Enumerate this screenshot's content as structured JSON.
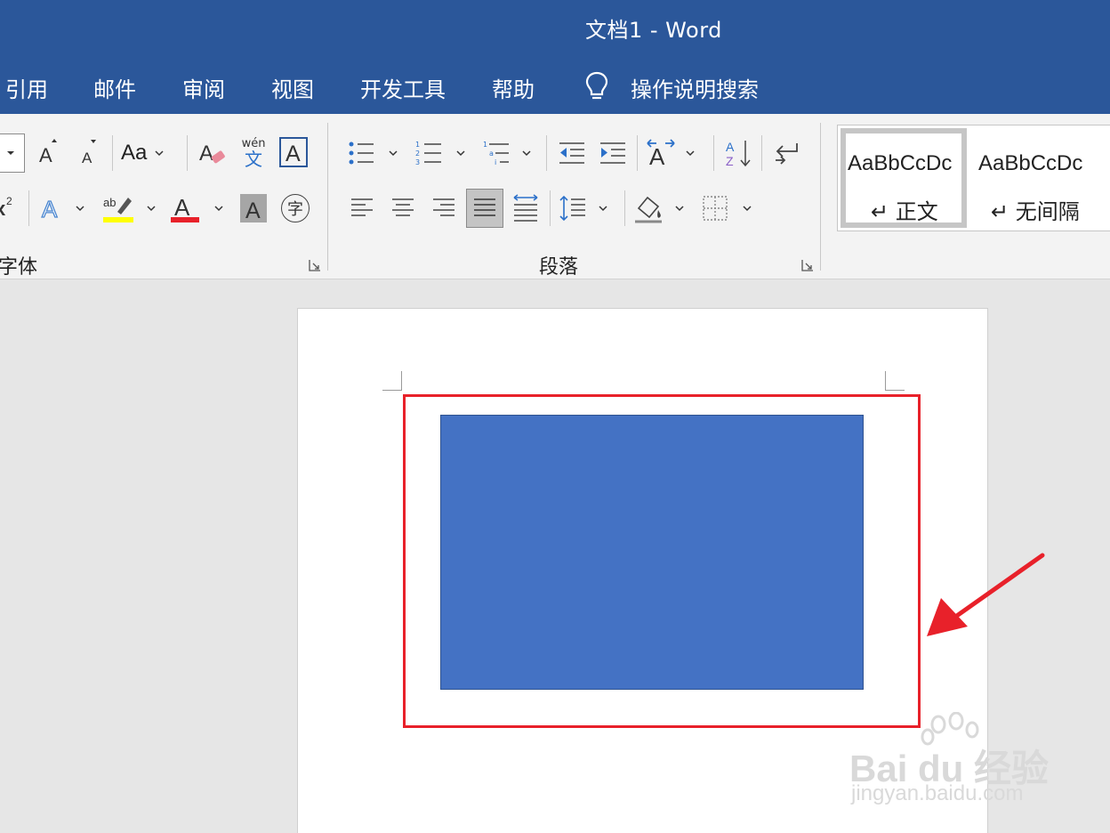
{
  "window": {
    "title": "文档1  -  Word"
  },
  "tabs": [
    "引用",
    "邮件",
    "审阅",
    "视图",
    "开发工具",
    "帮助"
  ],
  "tell_me": {
    "label": "操作说明搜索"
  },
  "ribbon": {
    "font_group": {
      "label": "字体",
      "change_case_label": "Aa",
      "phonetic_top": "wén",
      "phonetic_bottom": "文",
      "enclose_char": "字",
      "highlight_color": "#ffff00",
      "font_color": "#e8212a"
    },
    "paragraph_group": {
      "label": "段落"
    },
    "styles_group": {
      "items": [
        {
          "sample": "AaBbCcDc",
          "name": "正文"
        },
        {
          "sample": "AaBbCcDc",
          "name": "无间隔"
        }
      ]
    }
  },
  "document": {
    "shape_color": "#4472c4",
    "highlight_color": "#e8212a"
  },
  "watermark": {
    "brand": "Bai du 经验",
    "url": "jingyan.baidu.com"
  }
}
